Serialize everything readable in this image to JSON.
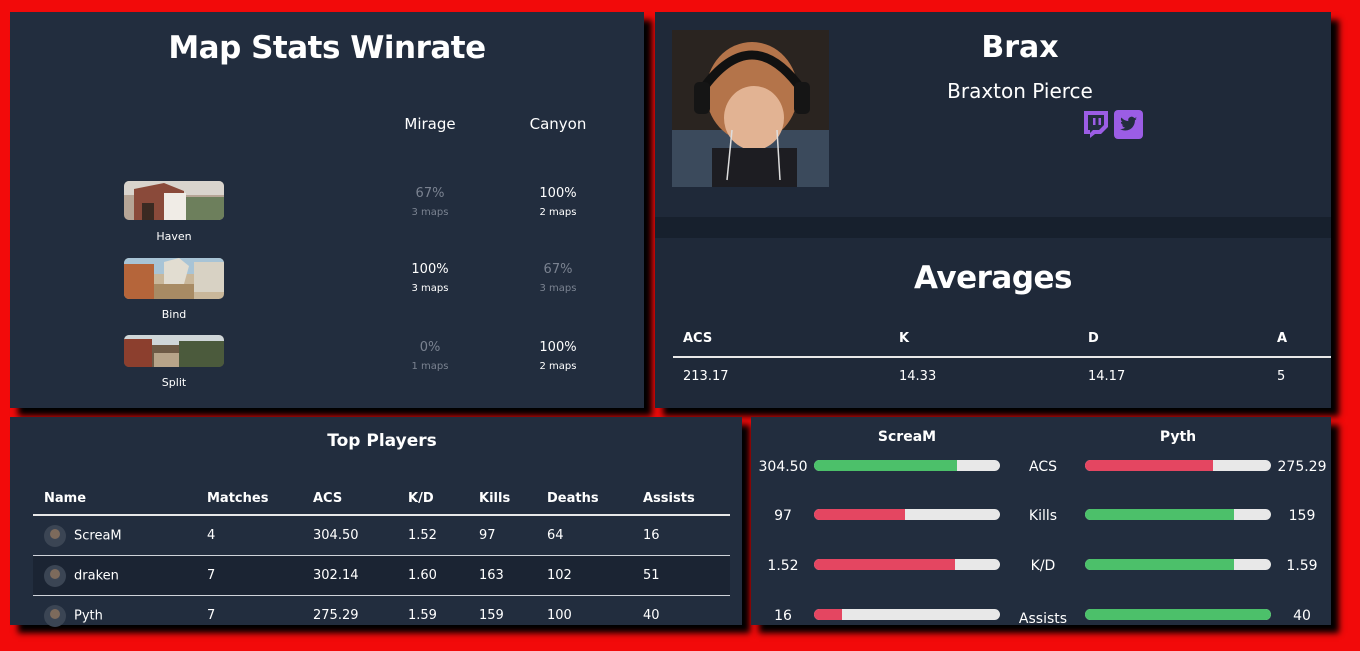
{
  "colors": {
    "accent_green": "#4cc06a",
    "accent_red": "#e44661",
    "bar_track": "#e8e8e8",
    "social": "#9b5de5"
  },
  "map_stats": {
    "title": "Map Stats Winrate",
    "columns": [
      "Mirage",
      "Canyon"
    ],
    "rows": [
      {
        "map": "Haven",
        "cells": [
          {
            "pct": "67%",
            "maps": "3 maps",
            "dim": true
          },
          {
            "pct": "100%",
            "maps": "2 maps",
            "dim": false
          }
        ]
      },
      {
        "map": "Bind",
        "cells": [
          {
            "pct": "100%",
            "maps": "3 maps",
            "dim": false
          },
          {
            "pct": "67%",
            "maps": "3 maps",
            "dim": true
          }
        ]
      },
      {
        "map": "Split",
        "cells": [
          {
            "pct": "0%",
            "maps": "1 maps",
            "dim": true
          },
          {
            "pct": "100%",
            "maps": "2 maps",
            "dim": false
          }
        ]
      }
    ]
  },
  "profile": {
    "handle": "Brax",
    "real_name": "Braxton Pierce",
    "socials": [
      {
        "icon": "twitch-icon"
      },
      {
        "icon": "twitter-icon"
      }
    ]
  },
  "averages": {
    "title": "Averages",
    "headers": [
      "ACS",
      "K",
      "D",
      "A"
    ],
    "values": [
      "213.17",
      "14.33",
      "14.17",
      "5"
    ]
  },
  "top_players": {
    "title": "Top Players",
    "headers": [
      "Name",
      "Matches",
      "ACS",
      "K/D",
      "Kills",
      "Deaths",
      "Assists"
    ],
    "rows": [
      [
        "ScreaM",
        "4",
        "304.50",
        "1.52",
        "97",
        "64",
        "16"
      ],
      [
        "draken",
        "7",
        "302.14",
        "1.60",
        "163",
        "102",
        "51"
      ],
      [
        "Pyth",
        "7",
        "275.29",
        "1.59",
        "159",
        "100",
        "40"
      ]
    ]
  },
  "comparison": {
    "left_player": "ScreaM",
    "right_player": "Pyth",
    "stats": [
      {
        "label": "ACS",
        "left": "304.50",
        "right": "275.29",
        "left_fill": 0.77,
        "right_fill": 0.69,
        "left_color": "green",
        "right_color": "red"
      },
      {
        "label": "Kills",
        "left": "97",
        "right": "159",
        "left_fill": 0.49,
        "right_fill": 0.8,
        "left_color": "red",
        "right_color": "green"
      },
      {
        "label": "K/D",
        "left": "1.52",
        "right": "1.59",
        "left_fill": 0.76,
        "right_fill": 0.8,
        "left_color": "red",
        "right_color": "green"
      },
      {
        "label": "Assists",
        "left": "16",
        "right": "40",
        "left_fill": 0.15,
        "right_fill": 1.0,
        "left_color": "red",
        "right_color": "green"
      }
    ]
  }
}
